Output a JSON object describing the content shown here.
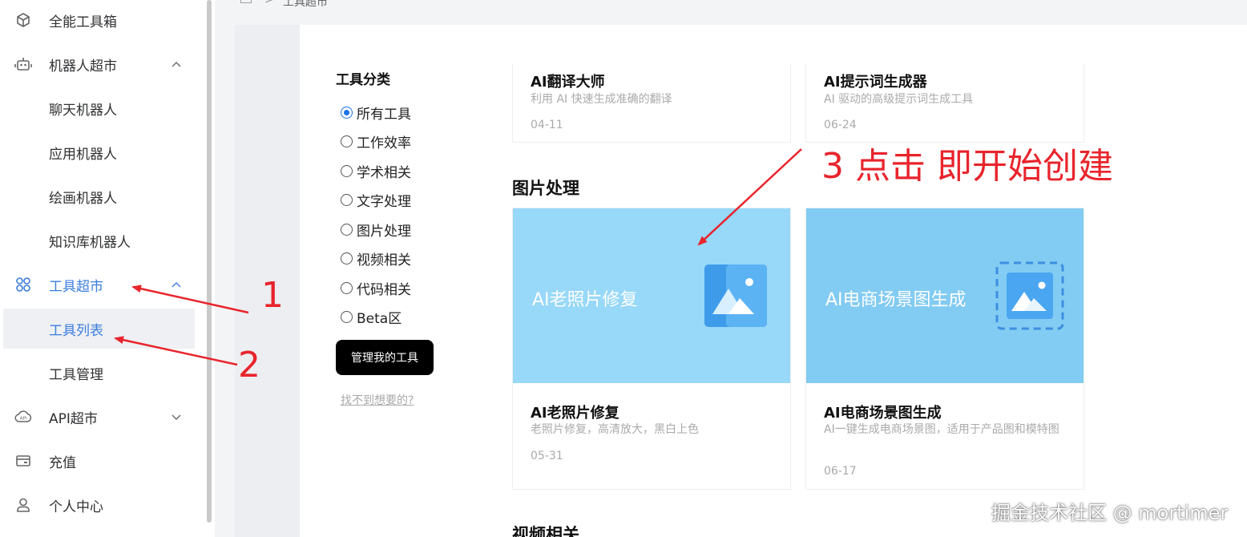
{
  "sidebar": {
    "items": [
      {
        "label": "全能工具箱",
        "icon": "cube-icon"
      },
      {
        "label": "机器人超市",
        "icon": "robot-icon"
      },
      {
        "label": "聊天机器人"
      },
      {
        "label": "应用机器人"
      },
      {
        "label": "绘画机器人"
      },
      {
        "label": "知识库机器人"
      },
      {
        "label": "工具超市",
        "icon": "grid-icon"
      },
      {
        "label": "工具列表"
      },
      {
        "label": "工具管理"
      },
      {
        "label": "API超市",
        "icon": "api-cloud-icon"
      },
      {
        "label": "充值",
        "icon": "wallet-icon"
      },
      {
        "label": "个人中心",
        "icon": "user-icon"
      }
    ]
  },
  "breadcrumb": {
    "sep": ">",
    "current": "工具超市"
  },
  "filter": {
    "title": "工具分类",
    "options": [
      "所有工具",
      "工作效率",
      "学术相关",
      "文字处理",
      "图片处理",
      "视频相关",
      "代码相关",
      "Beta区"
    ],
    "selected": "所有工具",
    "manage_button": "管理我的工具",
    "not_found_link": "找不到想要的?"
  },
  "cards_top": [
    {
      "title": "AI翻译大师",
      "desc": "利用 AI 快速生成准确的翻译",
      "date": "04-11"
    },
    {
      "title": "AI提示词生成器",
      "desc": "AI 驱动的高级提示词生成工具",
      "date": "06-24"
    }
  ],
  "sections": {
    "image": "图片处理",
    "video": "视频相关"
  },
  "cards_image": [
    {
      "banner": "AI老照片修复",
      "title": "AI老照片修复",
      "desc": "老照片修复，高清放大，黑白上色",
      "date": "05-31",
      "banner_color": "#98d8f8"
    },
    {
      "banner": "AI电商场景图生成",
      "title": "AI电商场景图生成",
      "desc": "AI一键生成电商场景图，适用于产品图和模特图",
      "date": "06-17",
      "banner_color": "#82cbf2"
    }
  ],
  "annotations": {
    "step1": "1",
    "step2": "2",
    "step3": "3 点击 即开始创建",
    "color": "#e8242c"
  },
  "watermark": "掘金技术社区 @ mortimer"
}
